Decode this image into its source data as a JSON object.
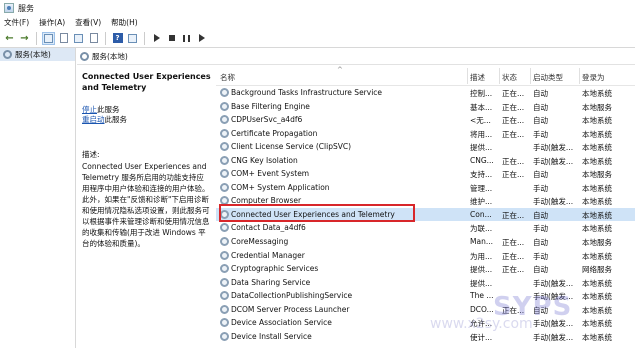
{
  "window": {
    "title": "服务"
  },
  "menu": [
    "文件(F)",
    "操作(A)",
    "查看(V)",
    "帮助(H)"
  ],
  "tree": {
    "root_label": "服务(本地)"
  },
  "pane": {
    "title": "服务(本地)"
  },
  "description_panel": {
    "service_title": "Connected User Experiences and Telemetry",
    "stop_link": "停止",
    "stop_suffix": "此服务",
    "restart_link": "重启动",
    "restart_suffix": "此服务",
    "desc_label": "描述:",
    "desc_text": "Connected User Experiences and Telemetry 服务所启用的功能支持应用程序中用户体验和连接的用户体验。此外，如果在\"反馈和诊断\"下启用诊断和使用情况隐私选项设置，则此服务可以根据事件来管理诊断和使用情况信息的收集和传输(用于改进 Windows 平台的体验和质量)。"
  },
  "table": {
    "columns": [
      "名称",
      "描述",
      "状态",
      "启动类型",
      "登录为"
    ],
    "selected_index": 9,
    "rows": [
      {
        "name": "Background Tasks Infrastructure Service",
        "desc": "控制...",
        "status": "正在...",
        "startup": "自动",
        "logon": "本地系统"
      },
      {
        "name": "Base Filtering Engine",
        "desc": "基本...",
        "status": "正在...",
        "startup": "自动",
        "logon": "本地服务"
      },
      {
        "name": "CDPUserSvc_a4df6",
        "desc": "<无...",
        "status": "正在...",
        "startup": "自动",
        "logon": "本地系统"
      },
      {
        "name": "Certificate Propagation",
        "desc": "将用...",
        "status": "正在...",
        "startup": "手动",
        "logon": "本地系统"
      },
      {
        "name": "Client License Service (ClipSVC)",
        "desc": "提供...",
        "status": "",
        "startup": "手动(触发...",
        "logon": "本地系统"
      },
      {
        "name": "CNG Key Isolation",
        "desc": "CNG...",
        "status": "正在...",
        "startup": "手动(触发...",
        "logon": "本地系统"
      },
      {
        "name": "COM+ Event System",
        "desc": "支持...",
        "status": "正在...",
        "startup": "自动",
        "logon": "本地服务"
      },
      {
        "name": "COM+ System Application",
        "desc": "管理...",
        "status": "",
        "startup": "手动",
        "logon": "本地系统"
      },
      {
        "name": "Computer Browser",
        "desc": "维护...",
        "status": "",
        "startup": "手动(触发...",
        "logon": "本地系统"
      },
      {
        "name": "Connected User Experiences and Telemetry",
        "desc": "Con...",
        "status": "正在...",
        "startup": "自动",
        "logon": "本地系统"
      },
      {
        "name": "Contact Data_a4df6",
        "desc": "为联...",
        "status": "",
        "startup": "手动",
        "logon": "本地系统"
      },
      {
        "name": "CoreMessaging",
        "desc": "Man...",
        "status": "正在...",
        "startup": "自动",
        "logon": "本地服务"
      },
      {
        "name": "Credential Manager",
        "desc": "为用...",
        "status": "正在...",
        "startup": "手动",
        "logon": "本地系统"
      },
      {
        "name": "Cryptographic Services",
        "desc": "提供...",
        "status": "正在...",
        "startup": "自动",
        "logon": "网络服务"
      },
      {
        "name": "Data Sharing Service",
        "desc": "提供...",
        "status": "",
        "startup": "手动(触发...",
        "logon": "本地系统"
      },
      {
        "name": "DataCollectionPublishingService",
        "desc": "The ...",
        "status": "",
        "startup": "手动(触发...",
        "logon": "本地系统"
      },
      {
        "name": "DCOM Server Process Launcher",
        "desc": "DCO...",
        "status": "正在...",
        "startup": "自动",
        "logon": "本地系统"
      },
      {
        "name": "Device Association Service",
        "desc": "允许...",
        "status": "",
        "startup": "手动(触发...",
        "logon": "本地系统"
      },
      {
        "name": "Device Install Service",
        "desc": "使计...",
        "status": "",
        "startup": "手动(触发...",
        "logon": "本地系统"
      }
    ]
  },
  "watermark": {
    "brand": "SYPS",
    "url": "www.x2sy.com"
  }
}
